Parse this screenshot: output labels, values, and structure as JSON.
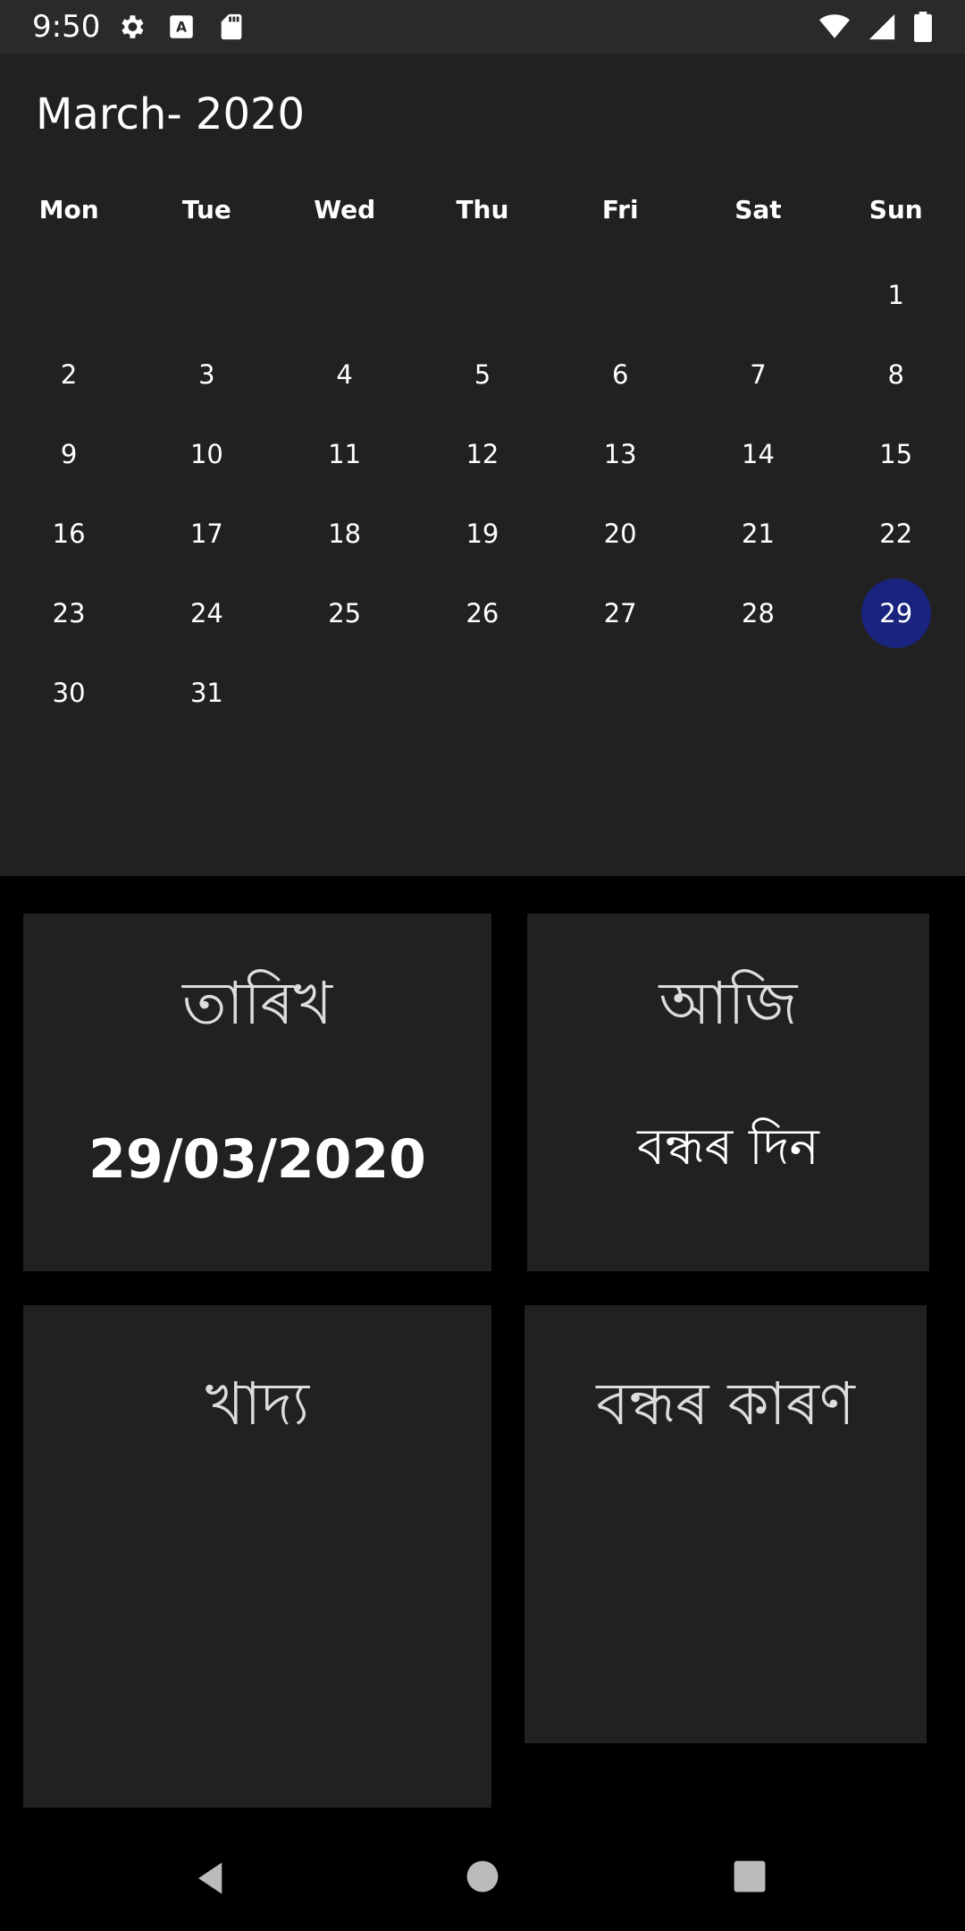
{
  "status_bar": {
    "time": "9:50",
    "left_icons": [
      "gear-icon",
      "font-download-icon",
      "sd-card-icon"
    ],
    "right_icons": [
      "wifi-icon",
      "signal-icon",
      "battery-icon"
    ]
  },
  "header": {
    "title": "March- 2020"
  },
  "calendar": {
    "weekdays": [
      "Mon",
      "Tue",
      "Wed",
      "Thu",
      "Fri",
      "Sat",
      "Sun"
    ],
    "leading_blanks": 6,
    "days": [
      "1",
      "2",
      "3",
      "4",
      "5",
      "6",
      "7",
      "8",
      "9",
      "10",
      "11",
      "12",
      "13",
      "14",
      "15",
      "16",
      "17",
      "18",
      "19",
      "20",
      "21",
      "22",
      "23",
      "24",
      "25",
      "26",
      "27",
      "28",
      "29",
      "30",
      "31"
    ],
    "selected_day": "29",
    "selected_color": "#1a237e"
  },
  "cards": {
    "date": {
      "title": "তাৰিখ",
      "value": "29/03/2020"
    },
    "today": {
      "title": "আজি",
      "value": "বন্ধৰ দিন"
    },
    "food": {
      "title": "খাদ্য"
    },
    "reason": {
      "title": "বন্ধৰ কাৰণ"
    }
  },
  "nav": {
    "back": "back-icon",
    "home": "home-icon",
    "recents": "recents-icon"
  },
  "colors": {
    "background": "#000000",
    "surface": "#212121",
    "accent": "#1a237e"
  }
}
